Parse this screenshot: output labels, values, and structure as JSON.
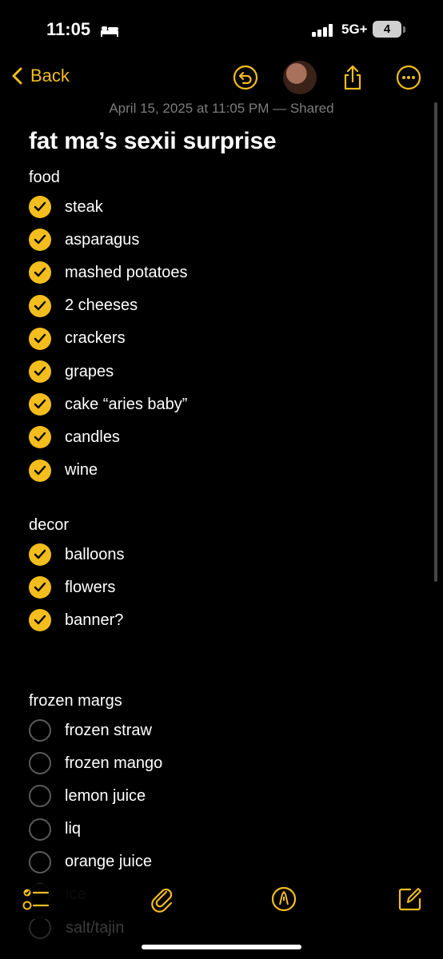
{
  "status": {
    "time": "11:05",
    "network": "5G+",
    "battery": "4"
  },
  "nav": {
    "back_label": "Back"
  },
  "meta": {
    "date": "April 15, 2025 at 11:05 PM — Shared"
  },
  "note": {
    "title": "fat ma’s sexii surprise"
  },
  "sections": [
    {
      "title": "food",
      "items": [
        {
          "text": "steak",
          "checked": true
        },
        {
          "text": "asparagus",
          "checked": true
        },
        {
          "text": "mashed potatoes",
          "checked": true
        },
        {
          "text": "2 cheeses",
          "checked": true
        },
        {
          "text": "crackers",
          "checked": true
        },
        {
          "text": "grapes",
          "checked": true
        },
        {
          "text": "cake “aries baby”",
          "checked": true
        },
        {
          "text": "candles",
          "checked": true
        },
        {
          "text": "wine",
          "checked": true
        }
      ]
    },
    {
      "title": "decor",
      "items": [
        {
          "text": "balloons",
          "checked": true
        },
        {
          "text": "flowers",
          "checked": true
        },
        {
          "text": "banner?",
          "checked": true
        }
      ]
    },
    {
      "title": "frozen margs",
      "items": [
        {
          "text": "frozen straw",
          "checked": false
        },
        {
          "text": "frozen mango",
          "checked": false
        },
        {
          "text": "lemon juice",
          "checked": false
        },
        {
          "text": "liq",
          "checked": false
        },
        {
          "text": "orange juice",
          "checked": false
        }
      ]
    }
  ],
  "partial_items": {
    "item_a": "ice",
    "item_b": "salt/tajin"
  },
  "colors": {
    "accent": "#f2bd1d",
    "background": "#000000",
    "muted_text": "#7c7c7c"
  }
}
